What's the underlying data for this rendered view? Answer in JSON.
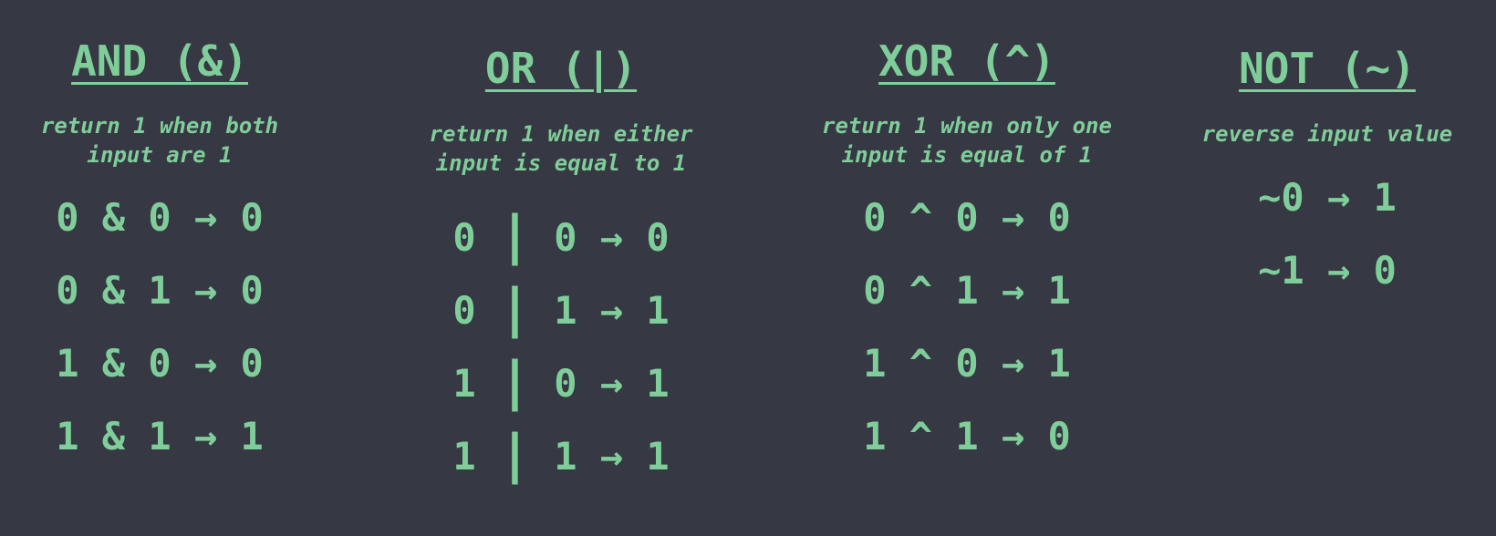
{
  "and": {
    "title": "AND (&)",
    "desc_line1": "return 1 when both",
    "desc_line2": "input are 1",
    "rows": [
      "0 & 0 → 0",
      "0 & 1 → 0",
      "1 & 0 → 0",
      "1 & 1 → 1"
    ]
  },
  "or": {
    "title": "OR (|)",
    "desc_line1": "return 1 when either",
    "desc_line2": "input is equal to 1",
    "rows": [
      {
        "a": "0",
        "op": "|",
        "rest": "0 → 0"
      },
      {
        "a": "0",
        "op": "|",
        "rest": "1 → 1"
      },
      {
        "a": "1",
        "op": "|",
        "rest": "0 → 1"
      },
      {
        "a": "1",
        "op": "|",
        "rest": "1 → 1"
      }
    ]
  },
  "xor": {
    "title": "XOR (^)",
    "desc_line1": "return 1 when only one",
    "desc_line2": "input is equal of 1",
    "rows": [
      "0 ^ 0 → 0",
      "0 ^ 1 → 1",
      "1 ^ 0 → 1",
      "1 ^ 1 → 0"
    ]
  },
  "not": {
    "title": "NOT (~)",
    "desc_line1": "reverse input value",
    "rows": [
      "~0 → 1",
      "~1 → 0"
    ]
  },
  "colors": {
    "background": "#363843",
    "foreground": "#7fce9a"
  }
}
